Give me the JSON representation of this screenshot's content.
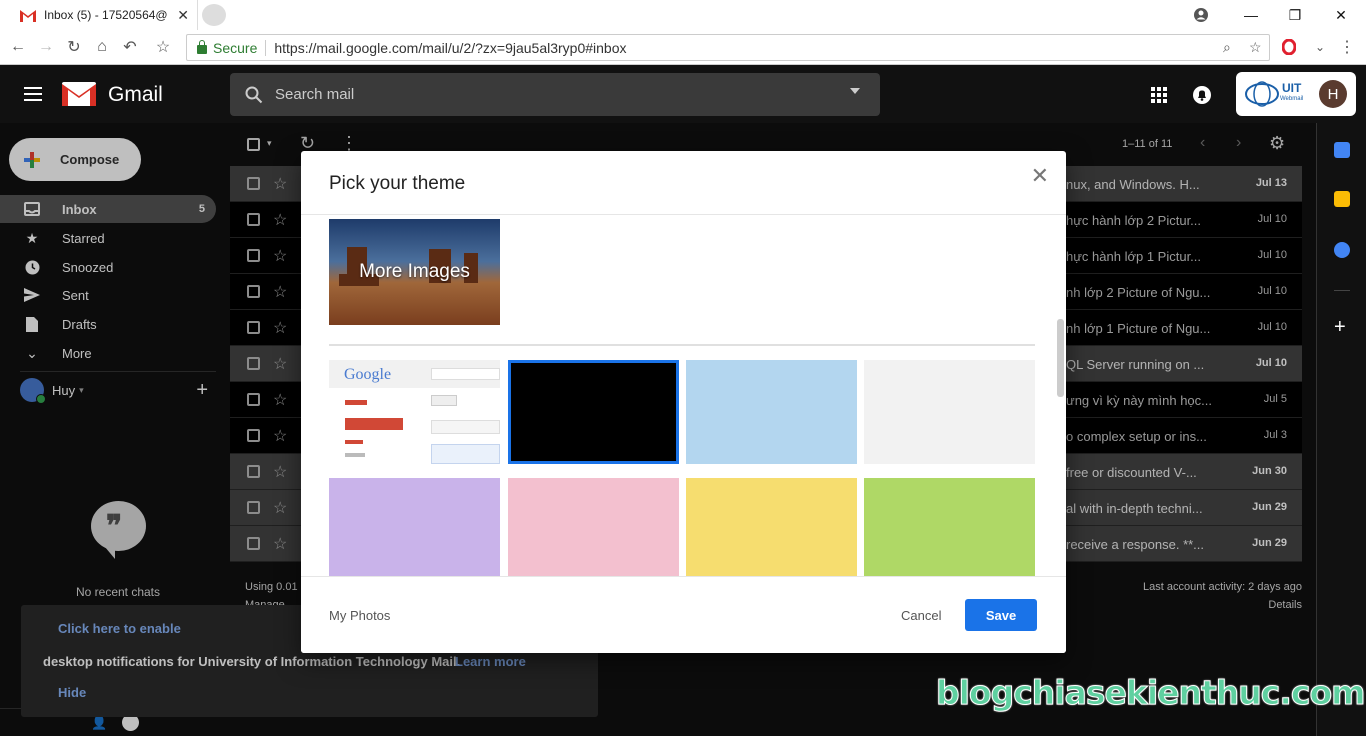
{
  "browser": {
    "tab_title": "Inbox (5) - 17520564@",
    "secure_label": "Secure",
    "url": "https://mail.google.com/mail/u/2/?zx=9jau5al3ryp0#inbox"
  },
  "header": {
    "app_name": "Gmail",
    "search_placeholder": "Search mail",
    "org_badge": "UIT",
    "org_badge_sub": "Webmail",
    "avatar_letter": "H"
  },
  "sidebar": {
    "compose_label": "Compose",
    "items": [
      {
        "label": "Inbox",
        "count": "5",
        "icon": "inbox-icon"
      },
      {
        "label": "Starred",
        "count": "",
        "icon": "star-icon"
      },
      {
        "label": "Snoozed",
        "count": "",
        "icon": "clock-icon"
      },
      {
        "label": "Sent",
        "count": "",
        "icon": "send-icon"
      },
      {
        "label": "Drafts",
        "count": "",
        "icon": "draft-icon"
      },
      {
        "label": "More",
        "count": "",
        "icon": "chevron-down-icon"
      }
    ],
    "user_name": "Huy",
    "no_chats": "No recent chats"
  },
  "notification": {
    "enable_link": "Click here to enable",
    "message": "desktop notifications for University of Information Technology Mail.",
    "learn_more": "Learn more",
    "hide": "Hide"
  },
  "list": {
    "range": "1–11 of 11",
    "rows": [
      {
        "snippet": "nux, and Windows. H...",
        "date": "Jul 13",
        "unread": true
      },
      {
        "snippet": "hực hành lớp 2 Pictur...",
        "date": "Jul 10",
        "unread": false
      },
      {
        "snippet": "hực hành lớp 1 Pictur...",
        "date": "Jul 10",
        "unread": false
      },
      {
        "snippet": "nh lớp 2 Picture of Ngu...",
        "date": "Jul 10",
        "unread": false
      },
      {
        "snippet": "nh lớp 1 Picture of Ngu...",
        "date": "Jul 10",
        "unread": false
      },
      {
        "snippet": "QL Server running on ...",
        "date": "Jul 10",
        "unread": true
      },
      {
        "snippet": "ưng vì kỳ này mình học...",
        "date": "Jul 5",
        "unread": false
      },
      {
        "snippet": "o complex setup or ins...",
        "date": "Jul 3",
        "unread": false
      },
      {
        "snippet": "free or discounted V-...",
        "date": "Jun 30",
        "unread": true
      },
      {
        "snippet": "al with in-depth techni...",
        "date": "Jun 29",
        "unread": true
      },
      {
        "snippet": "receive a response. **...",
        "date": "Jun 29",
        "unread": true
      }
    ],
    "footer_left_1": "Using 0.01",
    "footer_left_2": "Manage",
    "footer_right_1": "Last account activity: 2 days ago",
    "footer_right_2": "Details"
  },
  "modal": {
    "title": "Pick your theme",
    "more_images": "More Images",
    "themes": [
      {
        "name": "classic",
        "color": "#ffffff"
      },
      {
        "name": "dark",
        "color": "#000000"
      },
      {
        "name": "light-blue",
        "color": "#b3d6ef"
      },
      {
        "name": "light-gray",
        "color": "#f2f2f2"
      },
      {
        "name": "lavender",
        "color": "#c9b3ea"
      },
      {
        "name": "pink",
        "color": "#f3c0cf"
      },
      {
        "name": "yellow",
        "color": "#f6dd6f"
      },
      {
        "name": "green",
        "color": "#afd866"
      }
    ],
    "classic_google_text": "Google",
    "my_photos": "My Photos",
    "cancel": "Cancel",
    "save": "Save"
  },
  "watermark": "blogchiasekienthuc.com",
  "colors": {
    "accent": "#1a73e8",
    "selected_border": "#1a73e8"
  }
}
